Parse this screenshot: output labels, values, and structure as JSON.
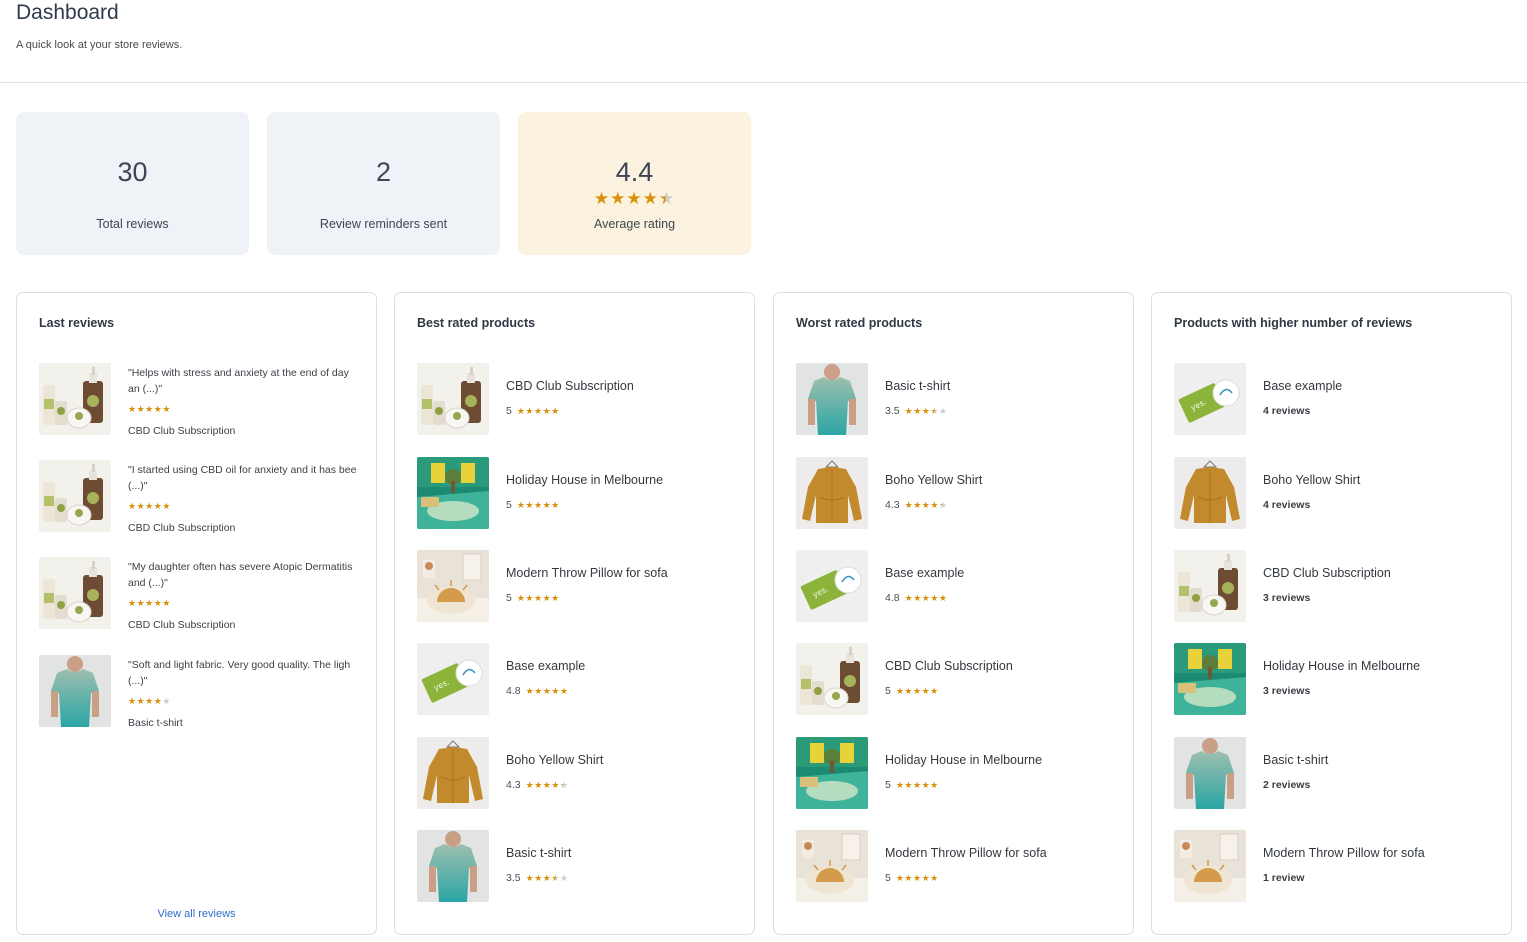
{
  "header": {
    "title": "Dashboard",
    "subtitle": "A quick look at your store reviews."
  },
  "stats": {
    "total_reviews": {
      "value": "30",
      "label": "Total reviews"
    },
    "reminders": {
      "value": "2",
      "label": "Review reminders sent"
    },
    "average": {
      "value": "4.4",
      "label": "Average rating",
      "rating": 4.4
    }
  },
  "colors": {
    "star": "#d8900d",
    "star_empty": "#c9ccd0",
    "link": "#2c6ecb",
    "rating_card_bg": "#fbf2df",
    "card_bg": "#eff3f8"
  },
  "last_reviews": {
    "title": "Last reviews",
    "view_all": "View all reviews",
    "items": [
      {
        "quote": "\"Helps with stress and anxiety at the end of day an (...)\"",
        "rating": 5,
        "product": "CBD Club Subscription",
        "image": "cbd-product-image"
      },
      {
        "quote": "\"I started using CBD oil for anxiety and it has bee (...)\"",
        "rating": 5,
        "product": "CBD Club Subscription",
        "image": "cbd-product-image"
      },
      {
        "quote": "\"My daughter often has severe Atopic Dermatitis and (...)\"",
        "rating": 5,
        "product": "CBD Club Subscription",
        "image": "cbd-product-image"
      },
      {
        "quote": "\"Soft and light fabric. Very good quality. The ligh (...)\"",
        "rating": 4,
        "product": "Basic t-shirt",
        "image": "tshirt-product-image"
      }
    ]
  },
  "best_rated": {
    "title": "Best rated products",
    "items": [
      {
        "name": "CBD Club Subscription",
        "score": "5",
        "rating": 5,
        "image": "cbd-product-image"
      },
      {
        "name": "Holiday House in Melbourne",
        "score": "5",
        "rating": 5,
        "image": "house-product-image"
      },
      {
        "name": "Modern Throw Pillow for sofa",
        "score": "5",
        "rating": 5,
        "image": "pillow-product-image"
      },
      {
        "name": "Base example",
        "score": "4.8",
        "rating": 4.8,
        "image": "card-product-image"
      },
      {
        "name": "Boho Yellow Shirt",
        "score": "4.3",
        "rating": 4.3,
        "image": "shirt-product-image"
      },
      {
        "name": "Basic t-shirt",
        "score": "3.5",
        "rating": 3.5,
        "image": "tshirt-product-image"
      }
    ]
  },
  "worst_rated": {
    "title": "Worst rated products",
    "items": [
      {
        "name": "Basic t-shirt",
        "score": "3.5",
        "rating": 3.5,
        "image": "tshirt-product-image"
      },
      {
        "name": "Boho Yellow Shirt",
        "score": "4.3",
        "rating": 4.3,
        "image": "shirt-product-image"
      },
      {
        "name": "Base example",
        "score": "4.8",
        "rating": 4.8,
        "image": "card-product-image"
      },
      {
        "name": "CBD Club Subscription",
        "score": "5",
        "rating": 5,
        "image": "cbd-product-image"
      },
      {
        "name": "Holiday House in Melbourne",
        "score": "5",
        "rating": 5,
        "image": "house-product-image"
      },
      {
        "name": "Modern Throw Pillow for sofa",
        "score": "5",
        "rating": 5,
        "image": "pillow-product-image"
      }
    ]
  },
  "most_reviewed": {
    "title": "Products with higher number of reviews",
    "items": [
      {
        "name": "Base example",
        "count": "4 reviews",
        "image": "card-product-image"
      },
      {
        "name": "Boho Yellow Shirt",
        "count": "4 reviews",
        "image": "shirt-product-image"
      },
      {
        "name": "CBD Club Subscription",
        "count": "3 reviews",
        "image": "cbd-product-image"
      },
      {
        "name": "Holiday House in Melbourne",
        "count": "3 reviews",
        "image": "house-product-image"
      },
      {
        "name": "Basic t-shirt",
        "count": "2 reviews",
        "image": "tshirt-product-image"
      },
      {
        "name": "Modern Throw Pillow for sofa",
        "count": "1 review",
        "image": "pillow-product-image"
      }
    ]
  }
}
